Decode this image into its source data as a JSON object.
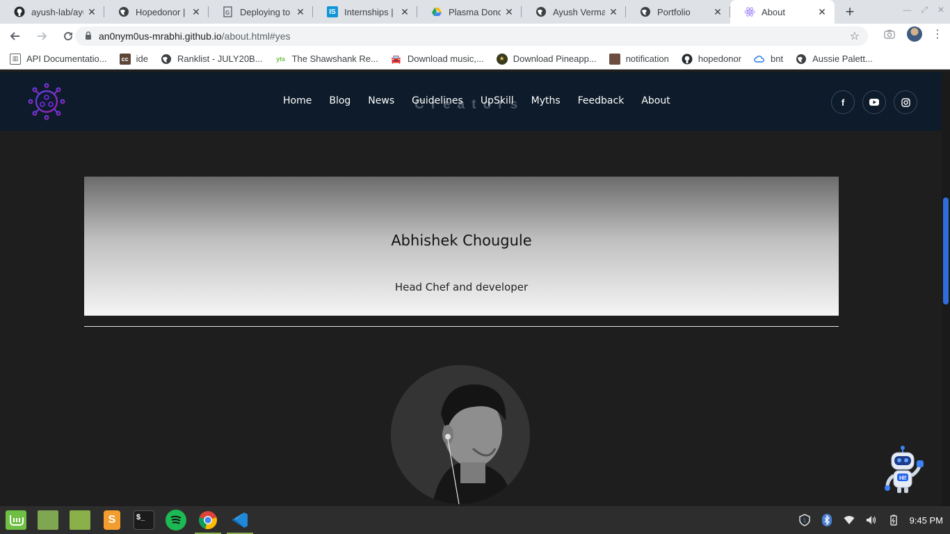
{
  "browser": {
    "tabs": [
      {
        "title": "ayush-lab/ayush",
        "icon": "github-icon",
        "active": false
      },
      {
        "title": "Hopedonor | Fr",
        "icon": "globe-icon",
        "active": false
      },
      {
        "title": "Deploying to Gi",
        "icon": "document-icon",
        "active": false
      },
      {
        "title": "Internships | Sc",
        "icon": "internshala-icon",
        "active": false
      },
      {
        "title": "Plasma Donor",
        "icon": "google-drive-icon",
        "active": false
      },
      {
        "title": "Ayush Verma",
        "icon": "globe-icon",
        "active": false
      },
      {
        "title": "Portfolio",
        "icon": "globe-icon",
        "active": false
      },
      {
        "title": "About",
        "icon": "react-icon",
        "active": true
      }
    ],
    "url_host": "an0nym0us-mrabhi.github.io",
    "url_path": "/about.html#yes",
    "bookmarks": [
      {
        "label": "API Documentatio...",
        "icon": "book-icon"
      },
      {
        "label": "ide",
        "icon": "codechef-icon"
      },
      {
        "label": "Ranklist - JULY20B...",
        "icon": "globe-icon"
      },
      {
        "label": "The Shawshank Re...",
        "icon": "yts-icon"
      },
      {
        "label": "Download music,...",
        "icon": "car-icon"
      },
      {
        "label": "Download Pineapp...",
        "icon": "badge-icon"
      },
      {
        "label": "notification",
        "icon": "avatar-icon"
      },
      {
        "label": "hopedonor",
        "icon": "github-icon"
      },
      {
        "label": "bnt",
        "icon": "cloud-icon"
      },
      {
        "label": "Aussie Palett...",
        "icon": "globe-icon"
      }
    ]
  },
  "site": {
    "nav": [
      "Home",
      "Blog",
      "News",
      "Guidelines",
      "UpSkill",
      "Myths",
      "Feedback",
      "About"
    ],
    "ghost_heading": "Creators",
    "social": [
      "facebook-icon",
      "youtube-icon",
      "instagram-icon"
    ]
  },
  "profile": {
    "name": "Abhishek Chougule",
    "role": "Head Chef and developer"
  },
  "taskbar": {
    "time": "9:45 PM",
    "apps": [
      "mint-menu-icon",
      "folder-icon",
      "files-icon",
      "sublime-text-icon",
      "terminal-icon",
      "spotify-icon",
      "chrome-icon",
      "vscode-icon"
    ]
  },
  "colors": {
    "nav_bg": "#0d1b2a",
    "page_bg": "#1e1e1e",
    "scroll_thumb": "#2f6ed8",
    "logo": "#7c3aed"
  }
}
